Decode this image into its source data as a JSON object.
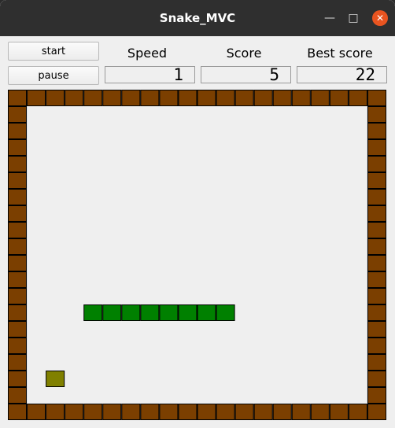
{
  "window": {
    "title": "Snake_MVC"
  },
  "controls": {
    "start_label": "start",
    "pause_label": "pause"
  },
  "stats": {
    "speed_label": "Speed",
    "score_label": "Score",
    "best_label": "Best score",
    "speed_value": "1",
    "score_value": "5",
    "best_value": "22"
  },
  "game": {
    "grid_cols": 20,
    "grid_rows": 20,
    "colors": {
      "wall": "#7b3f00",
      "snake": "#008000",
      "food": "#808000"
    },
    "snake": [
      [
        4,
        13
      ],
      [
        5,
        13
      ],
      [
        6,
        13
      ],
      [
        7,
        13
      ],
      [
        8,
        13
      ],
      [
        9,
        13
      ],
      [
        10,
        13
      ],
      [
        11,
        13
      ]
    ],
    "food": [
      2,
      17
    ]
  }
}
